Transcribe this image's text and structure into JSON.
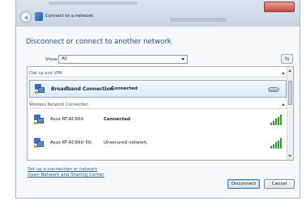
{
  "window": {
    "title": "Connect to a network"
  },
  "heading": "Disconnect or connect to another network",
  "filter": {
    "label": "Show",
    "selected": "All"
  },
  "groups": [
    {
      "label": "Dial-up and VPN",
      "items": [
        {
          "name": "Broadband Connection",
          "status": "Connected",
          "icon": "modem-icon",
          "selected": true
        }
      ]
    },
    {
      "label": "Wireless Network Connection",
      "items": [
        {
          "name": "Asus RT-AC66U",
          "status": "Connected",
          "icon": "wifi-signal-icon",
          "signal": 1.0
        },
        {
          "name": "Asus RT-AC66U-5G",
          "status": "Unsecured network",
          "icon": "wifi-signal-icon",
          "signal": 1.0
        }
      ]
    }
  ],
  "links": {
    "setup": "Set up a connection or network",
    "sharing": "Open Network and Sharing Center"
  },
  "buttons": {
    "disconnect": "Disconnect",
    "cancel": "Cancel"
  },
  "colors": {
    "heading": "#1f4f8f",
    "link": "#2461ad",
    "signal": "#2e9a2b"
  }
}
